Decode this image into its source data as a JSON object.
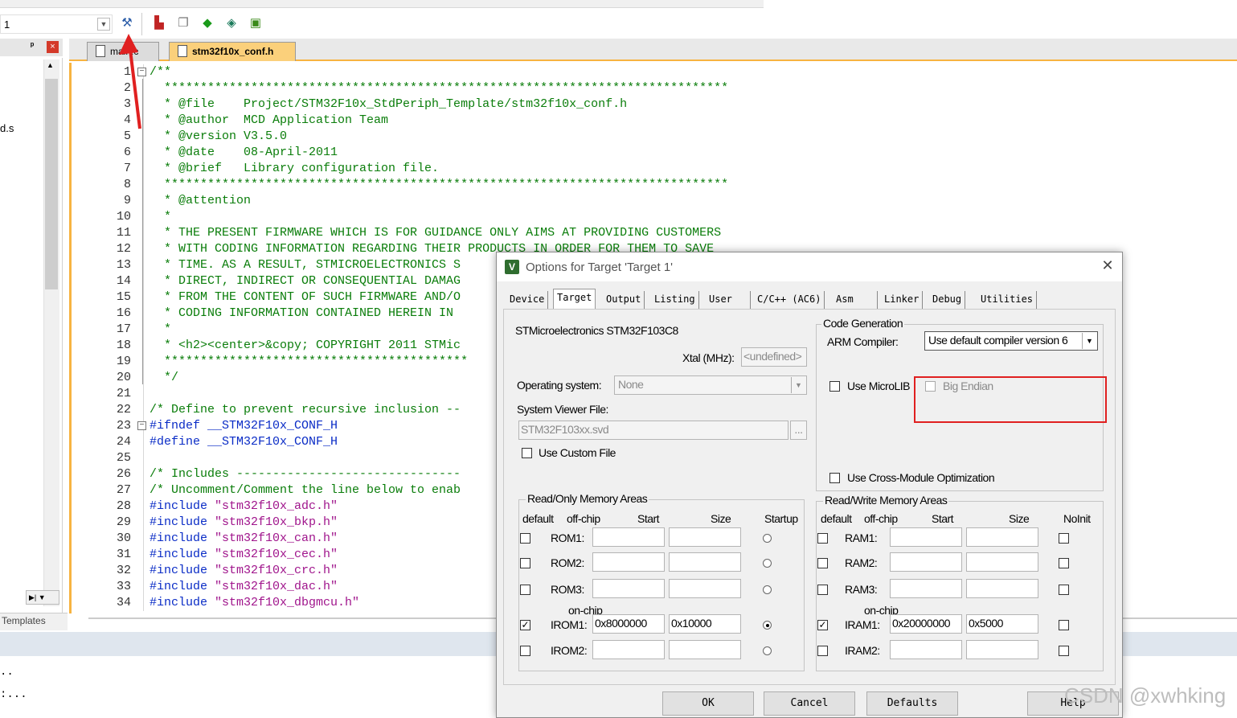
{
  "toolbar": {
    "target_name": "1",
    "icons": [
      "options-for-target-icon",
      "manage-project-icon",
      "copy-icon",
      "green-diamond-icon",
      "manage-packs-icon",
      "pack-installer-icon"
    ]
  },
  "project_panel": {
    "pin": "ᵖ",
    "close": "×",
    "partial_item": "d.s",
    "templates_tab": "Templates"
  },
  "editor": {
    "tabs": [
      {
        "label": "main.c",
        "active": false
      },
      {
        "label": "stm32f10x_conf.h",
        "active": true
      }
    ],
    "lines": [
      {
        "n": "1",
        "segs": [
          {
            "c": "cm",
            "t": "/**"
          }
        ],
        "fold": "⊟"
      },
      {
        "n": "2",
        "segs": [
          {
            "c": "cm",
            "t": "  ******************************************************************************"
          }
        ]
      },
      {
        "n": "3",
        "segs": [
          {
            "c": "cm",
            "t": "  * @file    Project/STM32F10x_StdPeriph_Template/stm32f10x_conf.h"
          }
        ]
      },
      {
        "n": "4",
        "segs": [
          {
            "c": "cm",
            "t": "  * @author  MCD Application Team"
          }
        ]
      },
      {
        "n": "5",
        "segs": [
          {
            "c": "cm",
            "t": "  * @version V3.5.0"
          }
        ]
      },
      {
        "n": "6",
        "segs": [
          {
            "c": "cm",
            "t": "  * @date    08-April-2011"
          }
        ]
      },
      {
        "n": "7",
        "segs": [
          {
            "c": "cm",
            "t": "  * @brief   Library configuration file."
          }
        ]
      },
      {
        "n": "8",
        "segs": [
          {
            "c": "cm",
            "t": "  ******************************************************************************"
          }
        ]
      },
      {
        "n": "9",
        "segs": [
          {
            "c": "cm",
            "t": "  * @attention"
          }
        ]
      },
      {
        "n": "10",
        "segs": [
          {
            "c": "cm",
            "t": "  *"
          }
        ]
      },
      {
        "n": "11",
        "segs": [
          {
            "c": "cm",
            "t": "  * THE PRESENT FIRMWARE WHICH IS FOR GUIDANCE ONLY AIMS AT PROVIDING CUSTOMERS"
          }
        ]
      },
      {
        "n": "12",
        "segs": [
          {
            "c": "cm",
            "t": "  * WITH CODING INFORMATION REGARDING THEIR PRODUCTS IN ORDER FOR THEM TO SAVE"
          }
        ]
      },
      {
        "n": "13",
        "segs": [
          {
            "c": "cm",
            "t": "  * TIME. AS A RESULT, STMICROELECTRONICS S"
          }
        ]
      },
      {
        "n": "14",
        "segs": [
          {
            "c": "cm",
            "t": "  * DIRECT, INDIRECT OR CONSEQUENTIAL DAMAG"
          }
        ]
      },
      {
        "n": "15",
        "segs": [
          {
            "c": "cm",
            "t": "  * FROM THE CONTENT OF SUCH FIRMWARE AND/O"
          }
        ]
      },
      {
        "n": "16",
        "segs": [
          {
            "c": "cm",
            "t": "  * CODING INFORMATION CONTAINED HEREIN IN "
          }
        ]
      },
      {
        "n": "17",
        "segs": [
          {
            "c": "cm",
            "t": "  *"
          }
        ]
      },
      {
        "n": "18",
        "segs": [
          {
            "c": "cm",
            "t": "  * <h2><center>&copy; COPYRIGHT 2011 STMic"
          }
        ]
      },
      {
        "n": "19",
        "segs": [
          {
            "c": "cm",
            "t": "  ******************************************"
          }
        ]
      },
      {
        "n": "20",
        "segs": [
          {
            "c": "cm",
            "t": "  */"
          }
        ]
      },
      {
        "n": "21",
        "segs": []
      },
      {
        "n": "22",
        "segs": [
          {
            "c": "cm",
            "t": "/* Define to prevent recursive inclusion --"
          }
        ]
      },
      {
        "n": "23",
        "segs": [
          {
            "c": "pp",
            "t": "#ifndef __STM32F10x_CONF_H"
          }
        ],
        "fold": "⊟"
      },
      {
        "n": "24",
        "segs": [
          {
            "c": "pp",
            "t": "#define __STM32F10x_CONF_H"
          }
        ]
      },
      {
        "n": "25",
        "segs": []
      },
      {
        "n": "26",
        "segs": [
          {
            "c": "cm",
            "t": "/* Includes -------------------------------"
          }
        ]
      },
      {
        "n": "27",
        "segs": [
          {
            "c": "cm",
            "t": "/* Uncomment/Comment the line below to enab"
          }
        ]
      },
      {
        "n": "28",
        "segs": [
          {
            "c": "pp",
            "t": "#include "
          },
          {
            "c": "st",
            "t": "\"stm32f10x_adc.h\""
          }
        ]
      },
      {
        "n": "29",
        "segs": [
          {
            "c": "pp",
            "t": "#include "
          },
          {
            "c": "st",
            "t": "\"stm32f10x_bkp.h\""
          }
        ]
      },
      {
        "n": "30",
        "segs": [
          {
            "c": "pp",
            "t": "#include "
          },
          {
            "c": "st",
            "t": "\"stm32f10x_can.h\""
          }
        ]
      },
      {
        "n": "31",
        "segs": [
          {
            "c": "pp",
            "t": "#include "
          },
          {
            "c": "st",
            "t": "\"stm32f10x_cec.h\""
          }
        ]
      },
      {
        "n": "32",
        "segs": [
          {
            "c": "pp",
            "t": "#include "
          },
          {
            "c": "st",
            "t": "\"stm32f10x_crc.h\""
          }
        ]
      },
      {
        "n": "33",
        "segs": [
          {
            "c": "pp",
            "t": "#include "
          },
          {
            "c": "st",
            "t": "\"stm32f10x_dac.h\""
          }
        ]
      },
      {
        "n": "34",
        "segs": [
          {
            "c": "pp",
            "t": "#include "
          },
          {
            "c": "st",
            "t": "\"stm32f10x_dbgmcu.h\""
          }
        ]
      }
    ]
  },
  "bottom_output": {
    "line1": "..",
    "line2": ":..."
  },
  "dialog": {
    "title": "Options for Target 'Target 1'",
    "tabs": [
      "Device",
      "Target",
      "Output",
      "Listing",
      "User",
      "C/C++ (AC6)",
      "Asm",
      "Linker",
      "Debug",
      "Utilities"
    ],
    "active_tab": "Target",
    "device": "STMicroelectronics STM32F103C8",
    "xtal_label": "Xtal (MHz):",
    "xtal_value": "<undefined>",
    "os_label": "Operating system:",
    "os_value": "None",
    "svd_label": "System Viewer File:",
    "svd_value": "STM32F103xx.svd",
    "browse": "...",
    "use_custom_file": "Use Custom File",
    "code_gen": {
      "title": "Code Generation",
      "compiler_label": "ARM Compiler:",
      "compiler_value": "Use default compiler version 6",
      "use_microlib": "Use MicroLIB",
      "big_endian": "Big Endian",
      "cross_module": "Use Cross-Module Optimization"
    },
    "rom": {
      "title": "Read/Only Memory Areas",
      "headers": {
        "default": "default",
        "offchip": "off-chip",
        "start": "Start",
        "size": "Size",
        "last": "Startup"
      },
      "onchip": "on-chip",
      "rows": [
        {
          "label": "ROM1:",
          "start": "",
          "size": "",
          "checked": false,
          "selected": false
        },
        {
          "label": "ROM2:",
          "start": "",
          "size": "",
          "checked": false,
          "selected": false
        },
        {
          "label": "ROM3:",
          "start": "",
          "size": "",
          "checked": false,
          "selected": false
        },
        {
          "label": "IROM1:",
          "start": "0x8000000",
          "size": "0x10000",
          "checked": true,
          "selected": true
        },
        {
          "label": "IROM2:",
          "start": "",
          "size": "",
          "checked": false,
          "selected": false
        }
      ]
    },
    "ram": {
      "title": "Read/Write Memory Areas",
      "headers": {
        "default": "default",
        "offchip": "off-chip",
        "start": "Start",
        "size": "Size",
        "last": "NoInit"
      },
      "onchip": "on-chip",
      "rows": [
        {
          "label": "RAM1:",
          "start": "",
          "size": "",
          "checked": false,
          "noinit": false
        },
        {
          "label": "RAM2:",
          "start": "",
          "size": "",
          "checked": false,
          "noinit": false
        },
        {
          "label": "RAM3:",
          "start": "",
          "size": "",
          "checked": false,
          "noinit": false
        },
        {
          "label": "IRAM1:",
          "start": "0x20000000",
          "size": "0x5000",
          "checked": true,
          "noinit": false
        },
        {
          "label": "IRAM2:",
          "start": "",
          "size": "",
          "checked": false,
          "noinit": false
        }
      ]
    },
    "buttons": {
      "ok": "OK",
      "cancel": "Cancel",
      "defaults": "Defaults",
      "help": "Help"
    }
  },
  "watermark": "CSDN @xwhking",
  "colors": {
    "accent_tab": "#fbd07b",
    "highlight_box": "#e02020",
    "arrow": "#e02020",
    "comment": "#0a7d0a",
    "preprocessor": "#0a2cc6",
    "string": "#a0158c"
  }
}
